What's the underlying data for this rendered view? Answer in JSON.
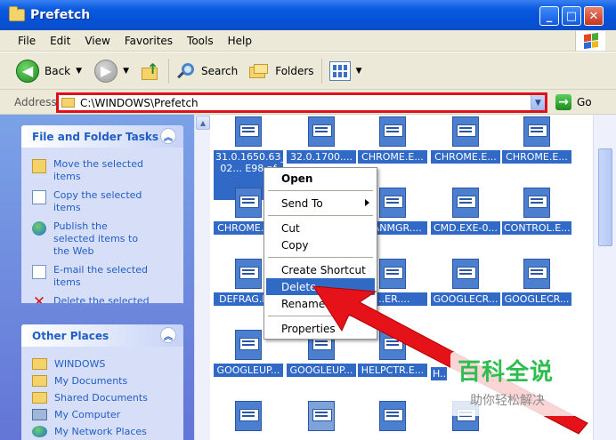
{
  "window": {
    "title": "Prefetch",
    "buttons": {
      "minimize": "_",
      "maximize": "□",
      "close": "✕"
    }
  },
  "menubar": {
    "items": [
      "File",
      "Edit",
      "View",
      "Favorites",
      "Tools",
      "Help"
    ]
  },
  "toolbar": {
    "back_label": "Back",
    "search_label": "Search",
    "folders_label": "Folders"
  },
  "address": {
    "label": "Address",
    "value": "C:\\WINDOWS\\Prefetch",
    "go_label": "Go"
  },
  "tasks_panel": {
    "title": "File and Folder Tasks",
    "items": [
      {
        "label": "Move the selected items",
        "icon": "move-icon"
      },
      {
        "label": "Copy the selected items",
        "icon": "copy-icon"
      },
      {
        "label": "Publish the selected items to the Web",
        "icon": "globe-icon"
      },
      {
        "label": "E-mail the selected items",
        "icon": "mail-icon"
      },
      {
        "label": "Delete the selected items",
        "icon": "delete-icon"
      }
    ]
  },
  "places_panel": {
    "title": "Other Places",
    "items": [
      {
        "label": "WINDOWS",
        "icon": "folder-icon"
      },
      {
        "label": "My Documents",
        "icon": "documents-icon"
      },
      {
        "label": "Shared Documents",
        "icon": "shared-folder-icon"
      },
      {
        "label": "My Computer",
        "icon": "computer-icon"
      },
      {
        "label": "My Network Places",
        "icon": "network-icon"
      }
    ]
  },
  "files": [
    "31.0.1650.63_31.0.1650.57_CHR-02... E98.pf",
    "32.0.1700....",
    "CHROME.E...",
    "CHROME.E...",
    "CHROME.E...",
    "CHROME.E...",
    "...ANMGR....",
    "CMD.EXE-0...",
    "CONTROL.E...",
    "DEFRAG.E...",
    "...ER....",
    "GOOGLECR...",
    "GOOGLECR...",
    "GOOGLEUP...",
    "GOOGLEUP...",
    "HELPCTR.E...",
    "H..."
  ],
  "context_menu": {
    "open": "Open",
    "send_to": "Send To",
    "cut": "Cut",
    "copy": "Copy",
    "create_shortcut": "Create Shortcut",
    "delete": "Delete",
    "rename": "Rename",
    "properties": "Properties"
  },
  "watermark": {
    "main": "百科全说",
    "sub": "助你轻松解决"
  }
}
